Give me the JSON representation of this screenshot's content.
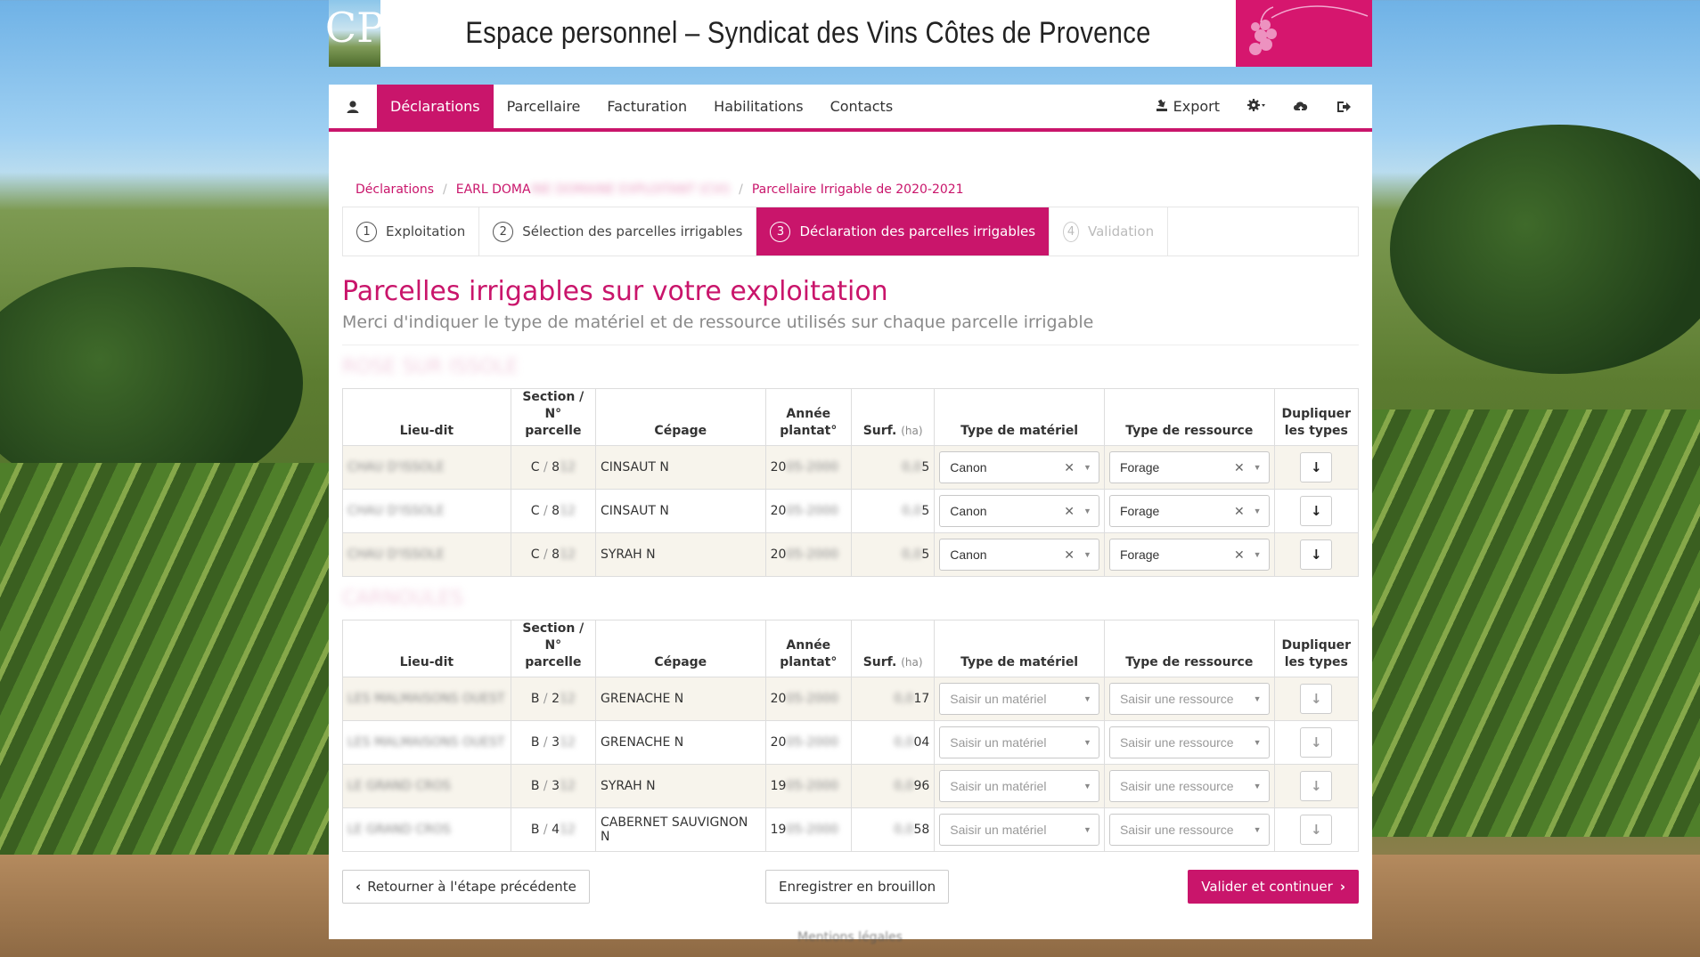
{
  "header": {
    "logo_text": "CP",
    "title": "Espace personnel – Syndicat des Vins Côtes de Provence"
  },
  "nav": {
    "user_icon": "user-icon",
    "items": [
      {
        "label": "Déclarations",
        "active": true
      },
      {
        "label": "Parcellaire"
      },
      {
        "label": "Facturation"
      },
      {
        "label": "Habilitations"
      },
      {
        "label": "Contacts"
      }
    ],
    "export_label": "Export"
  },
  "breadcrumb": {
    "item1": "Déclarations",
    "item2": "EARL DOMA",
    "item3": "Parcellaire Irrigable de 2020-2021"
  },
  "steps": [
    {
      "num": "1",
      "label": "Exploitation"
    },
    {
      "num": "2",
      "label": "Sélection des parcelles irrigables"
    },
    {
      "num": "3",
      "label": "Déclaration des parcelles irrigables"
    },
    {
      "num": "4",
      "label": "Validation"
    }
  ],
  "page": {
    "title": "Parcelles irrigables sur votre exploitation",
    "subtitle": "Merci d'indiquer le type de matériel et de ressource utilisés sur chaque parcelle irrigable"
  },
  "table_headers": {
    "lieu_dit": "Lieu-dit",
    "section_1": "Section /",
    "section_2": "N° parcelle",
    "cepage": "Cépage",
    "annee_1": "Année",
    "annee_2": "plantat°",
    "surf": "Surf.",
    "surf_unit": "(ha)",
    "materiel": "Type de matériel",
    "ressource": "Type de ressource",
    "dup_1": "Dupliquer",
    "dup_2": "les types"
  },
  "groups": [
    {
      "title": "ROSE SUR ISSOLE",
      "rows": [
        {
          "lieu": "CHAU D'ISSOLE",
          "section": "C",
          "sep": "/",
          "parcelle": "8",
          "cepage": "CINSAUT N",
          "annee": "20",
          "surf": "5",
          "materiel": "Canon",
          "ressource": "Forage"
        },
        {
          "lieu": "CHAU D'ISSOLE",
          "section": "C",
          "sep": "/",
          "parcelle": "8",
          "cepage": "CINSAUT N",
          "annee": "20",
          "surf": "5",
          "materiel": "Canon",
          "ressource": "Forage"
        },
        {
          "lieu": "CHAU D'ISSOLE",
          "section": "C",
          "sep": "/",
          "parcelle": "8",
          "cepage": "SYRAH N",
          "annee": "20",
          "surf": "5",
          "materiel": "Canon",
          "ressource": "Forage"
        }
      ]
    },
    {
      "title": "CARNOULES",
      "rows": [
        {
          "lieu": "LES MALMAISONS OUEST",
          "section": "B",
          "sep": "/",
          "parcelle": "2",
          "cepage": "GRENACHE N",
          "annee": "20",
          "surf": "17",
          "materiel": "Saisir un matériel",
          "ressource": "Saisir une ressource"
        },
        {
          "lieu": "LES MALMAISONS OUEST",
          "section": "B",
          "sep": "/",
          "parcelle": "3",
          "cepage": "GRENACHE N",
          "annee": "20",
          "surf": "04",
          "materiel": "Saisir un matériel",
          "ressource": "Saisir une ressource"
        },
        {
          "lieu": "LE GRAND CROS",
          "section": "B",
          "sep": "/",
          "parcelle": "3",
          "cepage": "SYRAH N",
          "annee": "19",
          "surf": "96",
          "materiel": "Saisir un matériel",
          "ressource": "Saisir une ressource"
        },
        {
          "lieu": "LE GRAND CROS",
          "section": "B",
          "sep": "/",
          "parcelle": "4",
          "cepage": "CABERNET SAUVIGNON N",
          "annee": "19",
          "surf": "58",
          "materiel": "Saisir un matériel",
          "ressource": "Saisir une ressource"
        }
      ]
    }
  ],
  "actions": {
    "back": "Retourner à l'étape précédente",
    "draft": "Enregistrer en brouillon",
    "next": "Valider et continuer"
  },
  "footer": "Mentions légales",
  "colors": {
    "accent": "#c9156b",
    "row_alt": "#f7f4ec"
  }
}
